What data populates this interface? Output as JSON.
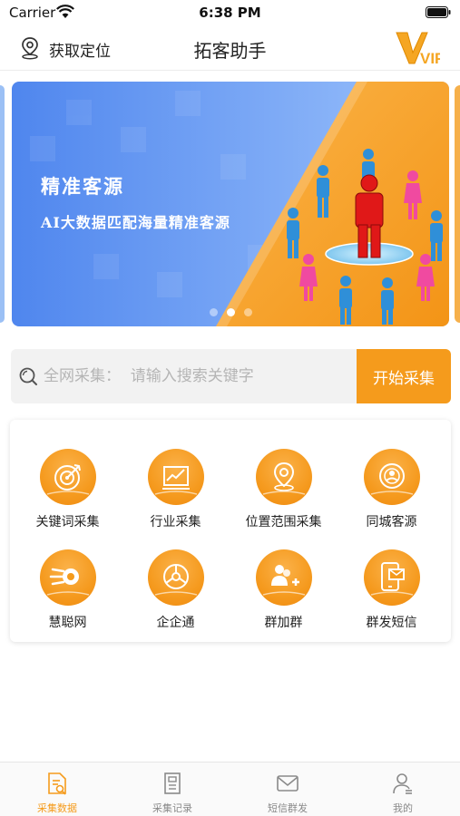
{
  "status_bar": {
    "carrier": "Carrier",
    "time": "6:38 PM",
    "icons": [
      "wifi-icon",
      "battery-icon"
    ]
  },
  "nav": {
    "location_label": "获取定位",
    "title": "拓客助手",
    "location_icon": "location-pin-icon",
    "vip_badge": "VIP"
  },
  "banner": {
    "title": "精准客源",
    "subtitle": "AI大数据匹配海量精准客源",
    "dot_count": 3,
    "active_dot": 2,
    "colors": {
      "left": "#5b8ff0",
      "right": "#f7a12c"
    }
  },
  "search": {
    "placeholder": "全网采集：  请输入搜索关键字",
    "value": "",
    "button_label": "开始采集"
  },
  "grid": {
    "items": [
      {
        "label": "关键词采集",
        "icon": "target-icon"
      },
      {
        "label": "行业采集",
        "icon": "chart-icon"
      },
      {
        "label": "位置范围采集",
        "icon": "location-pin-icon"
      },
      {
        "label": "同城客源",
        "icon": "badge-icon"
      },
      {
        "label": "慧聪网",
        "icon": "swirl-logo-icon"
      },
      {
        "label": "企企通",
        "icon": "compass-icon"
      },
      {
        "label": "群加群",
        "icon": "add-group-icon"
      },
      {
        "label": "群发短信",
        "icon": "message-phone-icon"
      }
    ],
    "icon_color": "#f59b1c"
  },
  "tabs": [
    {
      "label": "采集数据",
      "icon": "document-search-icon",
      "active": true
    },
    {
      "label": "采集记录",
      "icon": "record-icon",
      "active": false
    },
    {
      "label": "短信群发",
      "icon": "mail-icon",
      "active": false
    },
    {
      "label": "我的",
      "icon": "user-icon",
      "active": false
    }
  ],
  "accent_color": "#f59b1c"
}
